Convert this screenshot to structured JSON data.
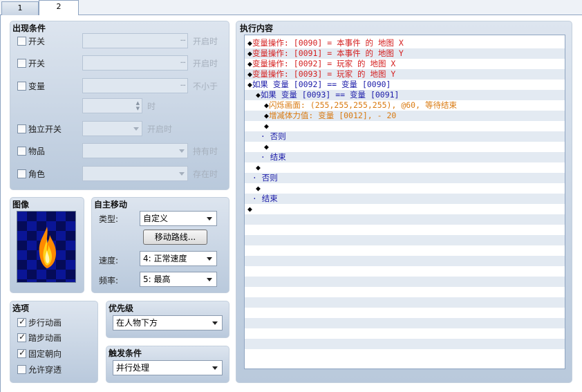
{
  "tabs": [
    "1",
    "2"
  ],
  "conditions": {
    "title": "出现条件",
    "switch1": {
      "label": "开关",
      "hint": "开启时"
    },
    "switch2": {
      "label": "开关",
      "hint": "开启时"
    },
    "variable": {
      "label": "变量",
      "hint": "不小于",
      "unit": "时"
    },
    "self_switch": {
      "label": "独立开关",
      "hint": "开启时"
    },
    "item": {
      "label": "物品",
      "hint": "持有时"
    },
    "actor": {
      "label": "角色",
      "hint": "存在时"
    }
  },
  "image": {
    "title": "图像"
  },
  "autonomous": {
    "title": "自主移动",
    "type_label": "类型:",
    "type_value": "自定义",
    "route_button": "移动路线...",
    "speed_label": "速度:",
    "speed_value": "4: 正常速度",
    "freq_label": "频率:",
    "freq_value": "5: 最高"
  },
  "options": {
    "title": "选项",
    "items": [
      {
        "label": "步行动画",
        "checked": true
      },
      {
        "label": "踏步动画",
        "checked": true
      },
      {
        "label": "固定朝向",
        "checked": true
      },
      {
        "label": "允许穿透",
        "checked": false
      }
    ]
  },
  "priority": {
    "title": "优先级",
    "value": "在人物下方"
  },
  "trigger": {
    "title": "触发条件",
    "value": "并行处理"
  },
  "contents": {
    "title": "执行内容",
    "lines": [
      {
        "indent": 0,
        "marker": "◆",
        "text": "变量操作: [0090] = 本事件 的 地图 X",
        "color": "red"
      },
      {
        "indent": 0,
        "marker": "◆",
        "text": "变量操作: [0091] = 本事件 的 地图 Y",
        "color": "red"
      },
      {
        "indent": 0,
        "marker": "◆",
        "text": "变量操作: [0092] = 玩家 的 地图 X",
        "color": "red"
      },
      {
        "indent": 0,
        "marker": "◆",
        "text": "变量操作: [0093] = 玩家 的 地图 Y",
        "color": "red"
      },
      {
        "indent": 0,
        "marker": "◆",
        "text": "如果 变量 [0092] == 变量 [0090]",
        "color": "blue"
      },
      {
        "indent": 1,
        "marker": "◆",
        "text": "如果 变量 [0093] == 变量 [0091]",
        "color": "blue"
      },
      {
        "indent": 2,
        "marker": "◆",
        "text": "闪烁画面: (255,255,255,255), @60, 等待结束",
        "color": "orange"
      },
      {
        "indent": 2,
        "marker": "◆",
        "text": "增减体力值: 变量 [0012], - 20",
        "color": "orange"
      },
      {
        "indent": 2,
        "marker": "◆",
        "text": "",
        "color": "black"
      },
      {
        "indent": 1,
        "marker": "·",
        "text": "否则",
        "color": "blue"
      },
      {
        "indent": 2,
        "marker": "◆",
        "text": "",
        "color": "black"
      },
      {
        "indent": 1,
        "marker": "·",
        "text": "结束",
        "color": "blue"
      },
      {
        "indent": 1,
        "marker": "◆",
        "text": "",
        "color": "black"
      },
      {
        "indent": 0,
        "marker": "·",
        "text": "否则",
        "color": "blue"
      },
      {
        "indent": 1,
        "marker": "◆",
        "text": "",
        "color": "black"
      },
      {
        "indent": 0,
        "marker": "·",
        "text": "结束",
        "color": "blue"
      },
      {
        "indent": 0,
        "marker": "◆",
        "text": "",
        "color": "black"
      }
    ]
  }
}
